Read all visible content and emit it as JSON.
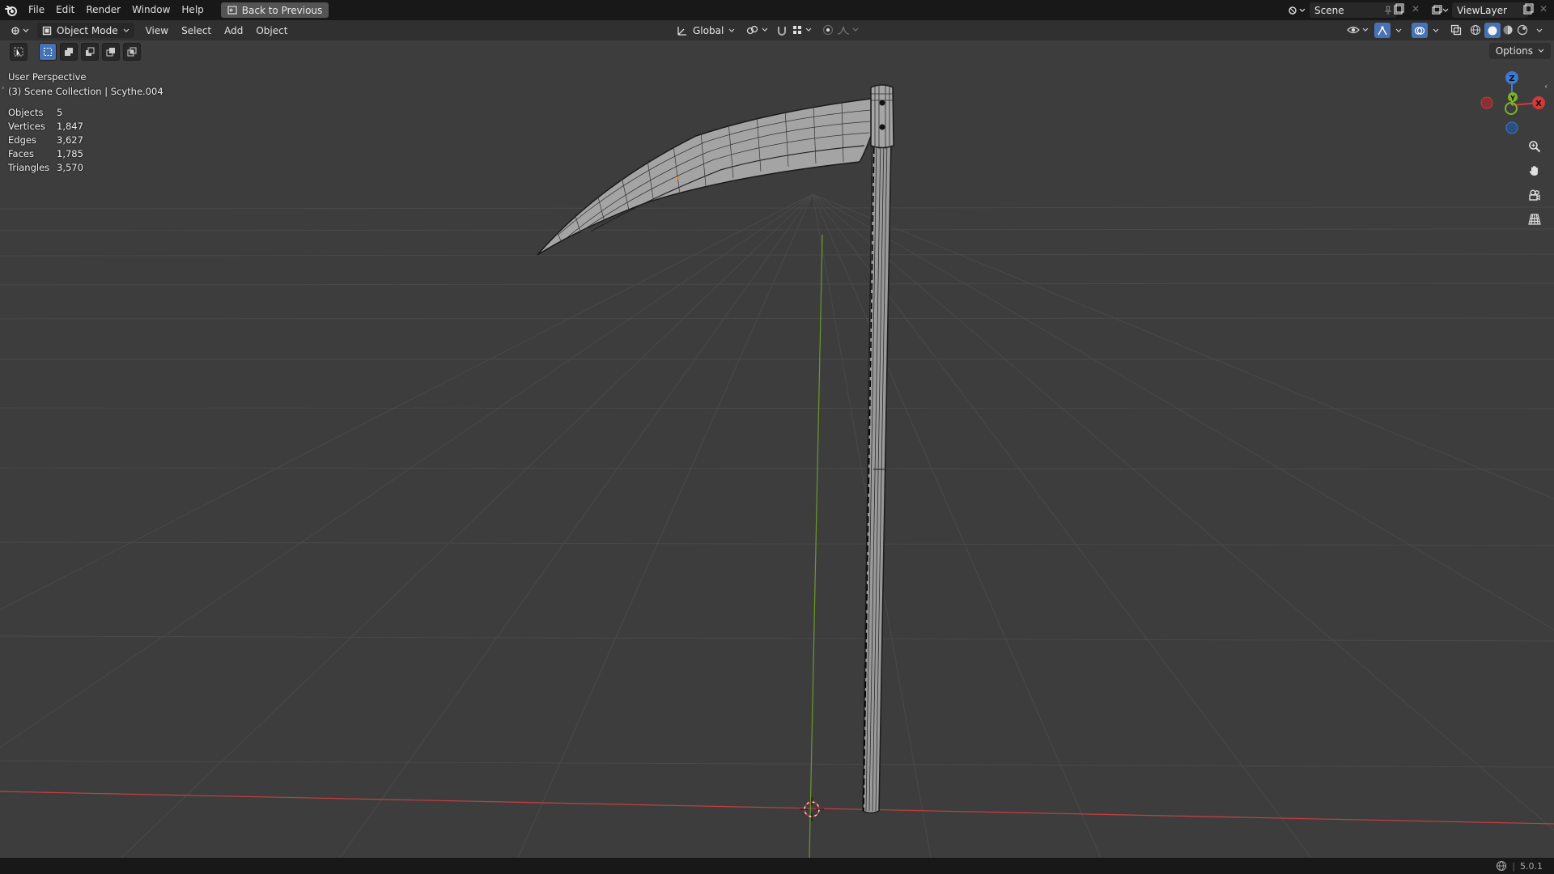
{
  "topbar": {
    "menus": [
      "File",
      "Edit",
      "Render",
      "Window",
      "Help"
    ],
    "back_label": "Back to Previous",
    "scene_name": "Scene",
    "view_layer": "ViewLayer"
  },
  "header": {
    "mode": "Object Mode",
    "menus": [
      "View",
      "Select",
      "Add",
      "Object"
    ],
    "transform_orientation": "Global"
  },
  "tool_settings": {
    "options_label": "Options"
  },
  "viewport": {
    "perspective": "User Perspective",
    "collection": "(3) Scene Collection | Scythe.004",
    "stats": [
      {
        "label": "Objects",
        "value": "5"
      },
      {
        "label": "Vertices",
        "value": "1,847"
      },
      {
        "label": "Edges",
        "value": "3,627"
      },
      {
        "label": "Faces",
        "value": "1,785"
      },
      {
        "label": "Triangles",
        "value": "3,570"
      }
    ],
    "gizmo": {
      "x": "X",
      "y": "Y",
      "z": "Z"
    }
  },
  "statusbar": {
    "version": "5.0.1"
  },
  "colors": {
    "accent": "#4772b3",
    "x_axis": "#d03a3a",
    "y_axis": "#7ab32a",
    "z_axis": "#3b7bd6"
  }
}
